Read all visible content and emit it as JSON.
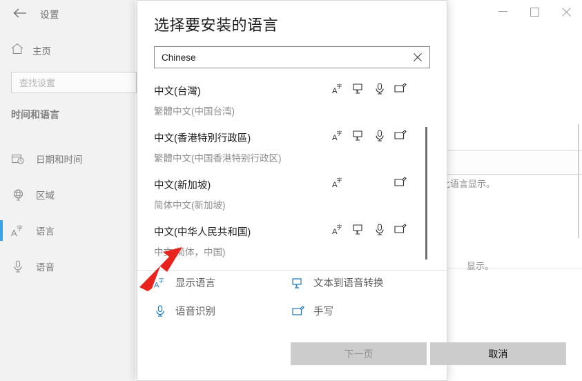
{
  "window": {
    "back_label": "←",
    "app_title": "设置",
    "controls": {
      "minimize": "minimize-icon",
      "maximize": "maximize-icon",
      "close": "close-icon"
    }
  },
  "sidebar": {
    "home_label": "主页",
    "home_icon": "home-icon",
    "search_placeholder": "查找设置",
    "section_title": "时间和语言",
    "items": [
      {
        "label": "日期和时间",
        "icon": "calendar-clock-icon",
        "selected": false
      },
      {
        "label": "区域",
        "icon": "globe-icon",
        "selected": false
      },
      {
        "label": "语言",
        "icon": "display-language-icon",
        "selected": true
      },
      {
        "label": "语音",
        "icon": "microphone-icon",
        "selected": false
      }
    ],
    "accent_color": "#3aa0e8"
  },
  "background_content": {
    "dropdown_value": "",
    "dropdown_chevron": "chevron-down-icon",
    "text_1": "用此语言显示。",
    "text_2": "显示。",
    "trailing_icons": [
      "display-language-icon",
      "spellcheck-icon"
    ]
  },
  "dialog": {
    "title": "选择要安装的语言",
    "search": {
      "value": "Chinese",
      "clear_icon": "close-icon"
    },
    "languages": [
      {
        "name": "中文(台灣)",
        "sub": "繁體中文(中国台湾)",
        "features": [
          "display-language-icon",
          "text-to-speech-icon",
          "speech-recognition-icon",
          "handwriting-icon"
        ]
      },
      {
        "name": "中文(香港特別行政區)",
        "sub": "繁體中文(中国香港特别行政区)",
        "features": [
          "display-language-icon",
          "text-to-speech-icon",
          "speech-recognition-icon",
          "handwriting-icon"
        ]
      },
      {
        "name": "中文(新加坡)",
        "sub": "简体中文(新加坡)",
        "features": [
          "display-language-icon",
          null,
          null,
          "handwriting-icon"
        ]
      },
      {
        "name": "中文(中华人民共和国)",
        "sub": "中文(简体，中国)",
        "features": [
          "display-language-icon",
          "text-to-speech-icon",
          "speech-recognition-icon",
          "handwriting-icon"
        ]
      }
    ],
    "legend": [
      {
        "label": "显示语言",
        "icon": "display-language-icon"
      },
      {
        "label": "文本到语音转换",
        "icon": "text-to-speech-icon"
      },
      {
        "label": "语音识别",
        "icon": "speech-recognition-icon"
      },
      {
        "label": "手写",
        "icon": "handwriting-icon"
      }
    ],
    "legend_color": "#1e7ac4",
    "buttons": {
      "next": "下一页",
      "cancel": "取消"
    }
  },
  "annotation": {
    "arrow_color": "#e8221d",
    "arrow_name": "red-pointer-arrow"
  }
}
